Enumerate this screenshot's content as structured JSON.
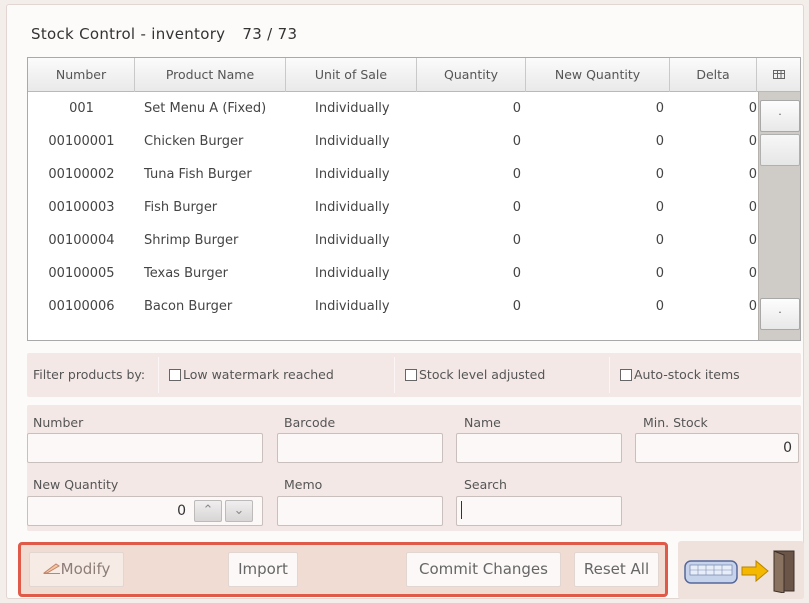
{
  "header": {
    "title": "Stock Control - inventory",
    "count": "73 / 73"
  },
  "table": {
    "columns": [
      "Number",
      "Product Name",
      "Unit of Sale",
      "Quantity",
      "New Quantity",
      "Delta"
    ],
    "rows": [
      {
        "number": "001",
        "name": "Set Menu A (Fixed)",
        "unit": "Individually",
        "quantity": "0",
        "new_quantity": "0",
        "delta": "0"
      },
      {
        "number": "00100001",
        "name": "Chicken Burger",
        "unit": "Individually",
        "quantity": "0",
        "new_quantity": "0",
        "delta": "0"
      },
      {
        "number": "00100002",
        "name": "Tuna Fish Burger",
        "unit": "Individually",
        "quantity": "0",
        "new_quantity": "0",
        "delta": "0"
      },
      {
        "number": "00100003",
        "name": "Fish Burger",
        "unit": "Individually",
        "quantity": "0",
        "new_quantity": "0",
        "delta": "0"
      },
      {
        "number": "00100004",
        "name": "Shrimp Burger",
        "unit": "Individually",
        "quantity": "0",
        "new_quantity": "0",
        "delta": "0"
      },
      {
        "number": "00100005",
        "name": "Texas Burger",
        "unit": "Individually",
        "quantity": "0",
        "new_quantity": "0",
        "delta": "0"
      },
      {
        "number": "00100006",
        "name": "Bacon Burger",
        "unit": "Individually",
        "quantity": "0",
        "new_quantity": "0",
        "delta": "0"
      }
    ],
    "column_chooser_icon": "column-chooser-icon"
  },
  "filter": {
    "label": "Filter products by:",
    "options": [
      "Low watermark reached",
      "Stock level adjusted",
      "Auto-stock items"
    ]
  },
  "form": {
    "number": {
      "label": "Number",
      "value": ""
    },
    "barcode": {
      "label": "Barcode",
      "value": ""
    },
    "name": {
      "label": "Name",
      "value": ""
    },
    "min_stock": {
      "label": "Min. Stock",
      "value": "0"
    },
    "new_quantity": {
      "label": "New Quantity",
      "value": "0"
    },
    "memo": {
      "label": "Memo",
      "value": ""
    },
    "search": {
      "label": "Search",
      "value": ""
    }
  },
  "actions": {
    "modify": "Modify",
    "import": "Import",
    "commit": "Commit Changes",
    "reset": "Reset All"
  },
  "colors": {
    "action_border": "#e05a4a",
    "panel": "#f3e8e6",
    "exit_arrow": "#f5b800"
  }
}
